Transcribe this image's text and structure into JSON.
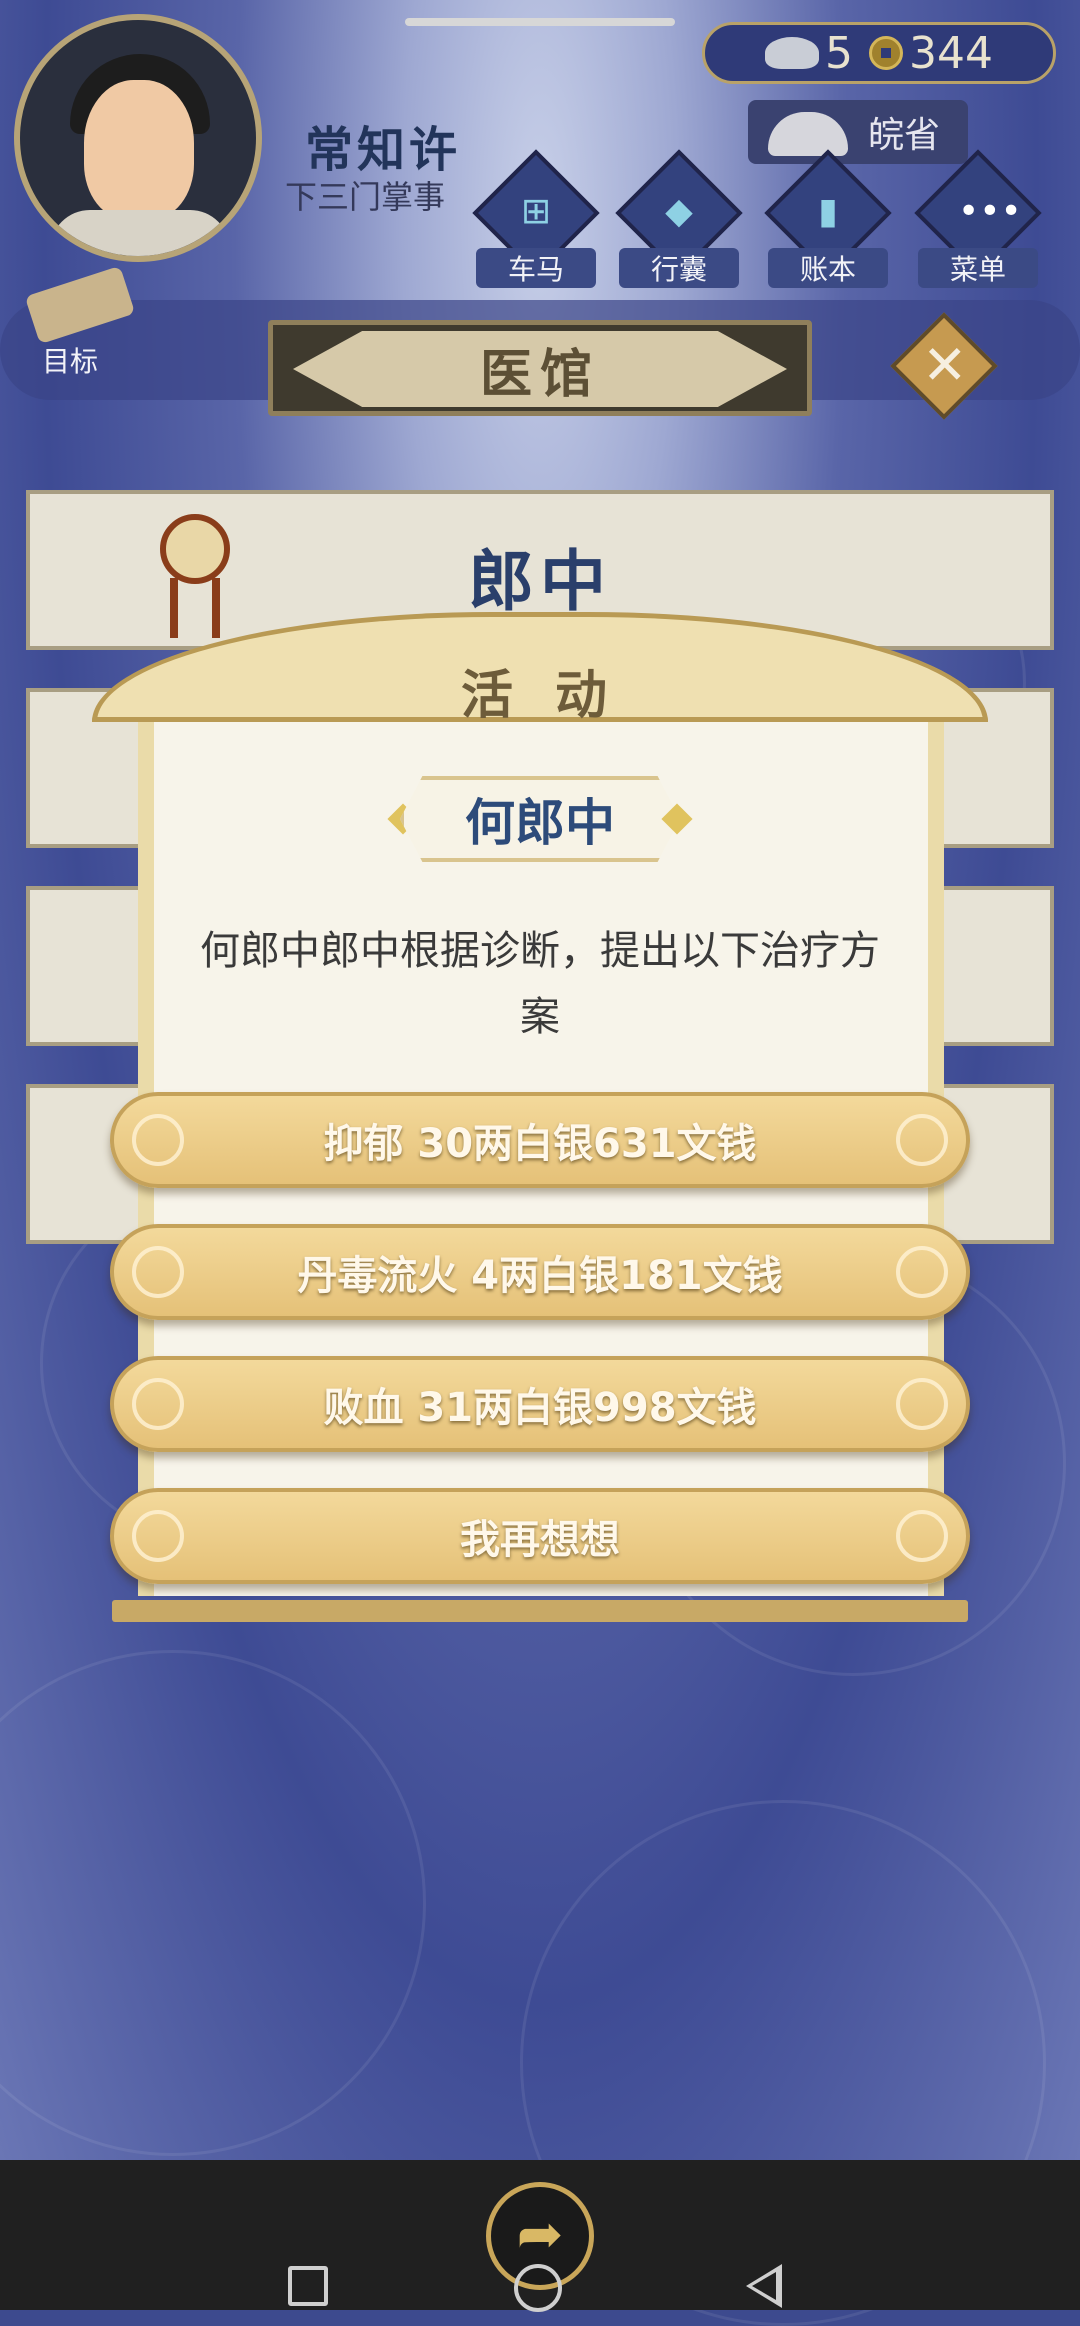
{
  "player": {
    "name": "常知许",
    "rank": "下三门掌事"
  },
  "currency": {
    "silver": "5",
    "coins": "344"
  },
  "province": "皖省",
  "menu": {
    "carriage": "车马",
    "luggage": "行囊",
    "ledger": "账本",
    "menu": "菜单"
  },
  "goal_label": "目标",
  "location_title": "医馆",
  "close_symbol": "✕",
  "card_title": "郎中",
  "dialog": {
    "header": "活 动",
    "npc_name": "何郎中",
    "description": "何郎中郎中根据诊断，提出以下治疗方案",
    "options": [
      "抑郁 30两白银631文钱",
      "丹毒流火 4两白银181文钱",
      "败血 31两白银998文钱",
      "我再想想"
    ]
  },
  "colors": {
    "gold": "#e5c178",
    "navy": "#3e4b94",
    "ink_blue": "#2d4b7a"
  }
}
